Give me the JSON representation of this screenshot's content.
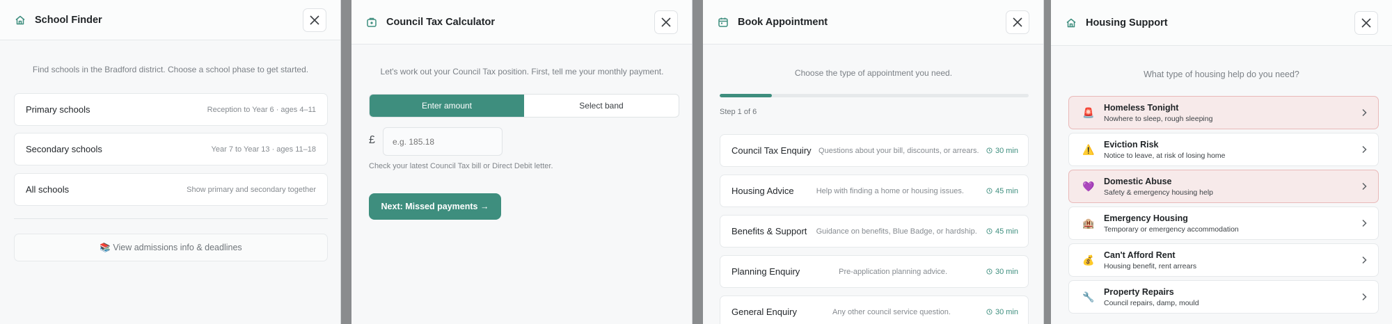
{
  "colors": {
    "accent": "#3e8e7e",
    "urgent_bg": "#f7eaea",
    "urgent_border": "#e9b9b9"
  },
  "school_finder": {
    "title": "School Finder",
    "icon": "home-icon",
    "intro": "Find schools in the Bradford district. Choose a school phase to get started.",
    "options": [
      {
        "label": "Primary schools",
        "detail": "Reception to Year 6 · ages 4–11"
      },
      {
        "label": "Secondary schools",
        "detail": "Year 7 to Year 13 · ages 11–18"
      },
      {
        "label": "All schools",
        "detail": "Show primary and secondary together"
      }
    ],
    "admissions_link": "📚 View admissions info & deadlines"
  },
  "council_tax": {
    "title": "Council Tax Calculator",
    "icon": "calculator-icon",
    "intro": "Let's work out your Council Tax position. First, tell me your monthly payment.",
    "tabs": [
      {
        "label": "Enter amount",
        "active": true
      },
      {
        "label": "Select band",
        "active": false
      }
    ],
    "currency": "£",
    "amount_placeholder": "e.g. 185.18",
    "hint": "Check your latest Council Tax bill or Direct Debit letter.",
    "next_button": "Next: Missed payments →"
  },
  "book_appointment": {
    "title": "Book Appointment",
    "icon": "calendar-icon",
    "intro": "Choose the type of appointment you need.",
    "progress": 0.17,
    "step_label": "Step 1 of 6",
    "appointments": [
      {
        "name": "Council Tax Enquiry",
        "desc": "Questions about your bill, discounts, or arrears.",
        "duration": "30 min"
      },
      {
        "name": "Housing Advice",
        "desc": "Help with finding a home or housing issues.",
        "duration": "45 min"
      },
      {
        "name": "Benefits & Support",
        "desc": "Guidance on benefits, Blue Badge, or hardship.",
        "duration": "45 min"
      },
      {
        "name": "Planning Enquiry",
        "desc": "Pre-application planning advice.",
        "duration": "30 min"
      },
      {
        "name": "General Enquiry",
        "desc": "Any other council service question.",
        "duration": "30 min"
      }
    ]
  },
  "housing_support": {
    "title": "Housing Support",
    "icon": "home-icon",
    "intro": "What type of housing help do you need?",
    "options": [
      {
        "emoji": "🚨",
        "title": "Homeless Tonight",
        "sub": "Nowhere to sleep, rough sleeping",
        "urgent": true
      },
      {
        "emoji": "⚠️",
        "title": "Eviction Risk",
        "sub": "Notice to leave, at risk of losing home",
        "urgent": false
      },
      {
        "emoji": "💜",
        "title": "Domestic Abuse",
        "sub": "Safety & emergency housing help",
        "urgent": true
      },
      {
        "emoji": "🏨",
        "title": "Emergency Housing",
        "sub": "Temporary or emergency accommodation",
        "urgent": false
      },
      {
        "emoji": "💰",
        "title": "Can't Afford Rent",
        "sub": "Housing benefit, rent arrears",
        "urgent": false
      },
      {
        "emoji": "🔧",
        "title": "Property Repairs",
        "sub": "Council repairs, damp, mould",
        "urgent": false
      }
    ]
  }
}
